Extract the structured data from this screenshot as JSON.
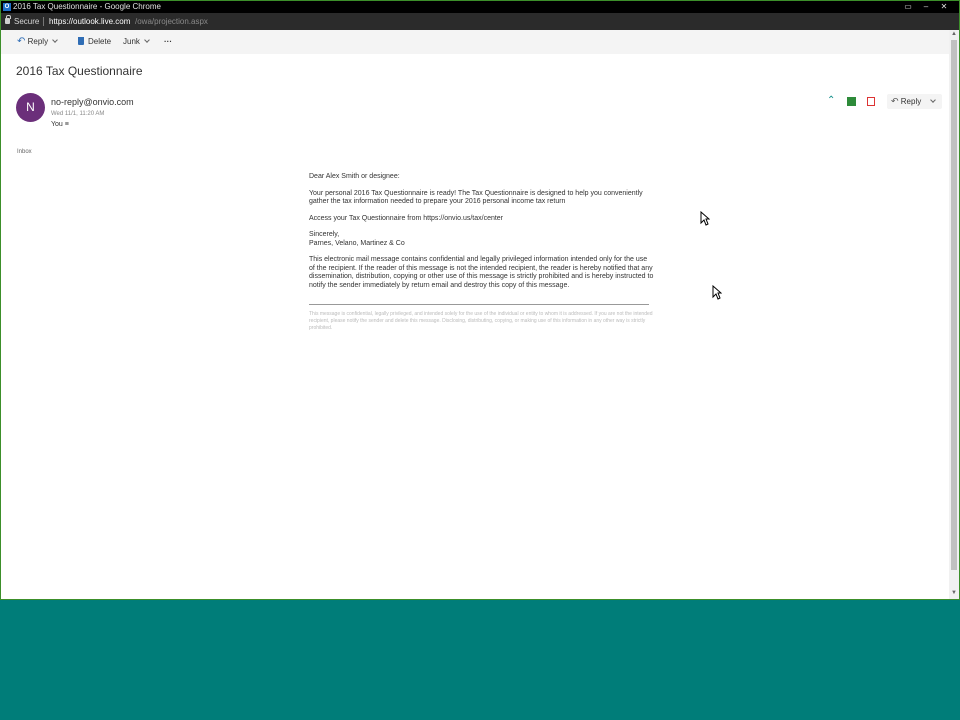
{
  "titlebar": {
    "app_icon_label": "O",
    "title": "2016 Tax Questionnaire - Google Chrome"
  },
  "addressbar": {
    "secure_label": "Secure",
    "url_host": "https://outlook.live.com",
    "url_path": "/owa/projection.aspx"
  },
  "toolbar": {
    "reply_label": "Reply",
    "delete_label": "Delete",
    "junk_label": "Junk",
    "more_label": "···"
  },
  "message": {
    "subject": "2016 Tax Questionnaire",
    "avatar_initial": "N",
    "sender": "no-reply@onvio.com",
    "date": "Wed 11/1, 11:20 AM",
    "to": "You ≡",
    "folder": "Inbox",
    "reply_label": "Reply"
  },
  "body": {
    "greeting": "Dear Alex Smith or designee:",
    "p1": "Your personal 2016 Tax Questionnaire is ready! The Tax Questionnaire is designed to help you conveniently gather the tax information needed to prepare your 2016 personal income tax return",
    "p2": "Access your Tax Questionnaire from https://onvio.us/tax/center",
    "signoff": "Sincerely,",
    "firm": "Parnes, Velano, Martinez & Co",
    "disclaimer": "This electronic mail message contains confidential and legally privileged information intended only for the use of the recipient. If the reader of this message is not the intended recipient, the reader is hereby notified that any dissemination, distribution, copying or other use of this message is strictly prohibited and is hereby instructed to notify the sender immediately by return email and destroy this copy of this message.",
    "fine_print": "This message is confidential, legally privileged, and intended solely for the use of the individual or entity to whom it is addressed. If you are not the intended recipient, please notify the sender and delete this message. Disclosing, distributing, copying, or making use of this information in any other way is strictly prohibited."
  },
  "colors": {
    "desktop": "#007d79",
    "avatar": "#6b2f7a",
    "accent": "#2f6db5"
  }
}
